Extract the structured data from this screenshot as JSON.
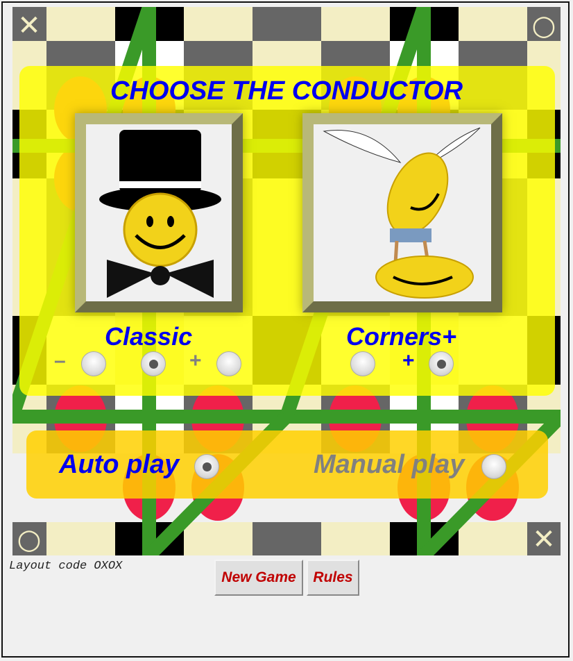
{
  "title": "CHOOSE THE CONDUCTOR",
  "conductors": [
    {
      "label": "Classic",
      "image": "smiley-top-hat-bow-tie"
    },
    {
      "label": "Corners+",
      "image": "flying-smiley-leapfrog"
    }
  ],
  "classic_options": {
    "minus": "–",
    "plus": "+",
    "selected_index": 1
  },
  "corners_options": {
    "plus": "+",
    "selected_index": 1
  },
  "play_modes": {
    "auto": "Auto play",
    "manual": "Manual play",
    "selected": "auto"
  },
  "corner_marks": {
    "top_left": "✕",
    "top_right": "○",
    "bottom_left": "○",
    "bottom_right": "✕"
  },
  "layout_code": "Layout code OXOX",
  "buttons": {
    "new_game": "New Game",
    "rules": "Rules"
  },
  "colors": {
    "accent": "#0000ee",
    "inactive": "#808080",
    "button_text": "#c00000",
    "lines": "#3a9a28",
    "pieces": "#f0204a"
  }
}
